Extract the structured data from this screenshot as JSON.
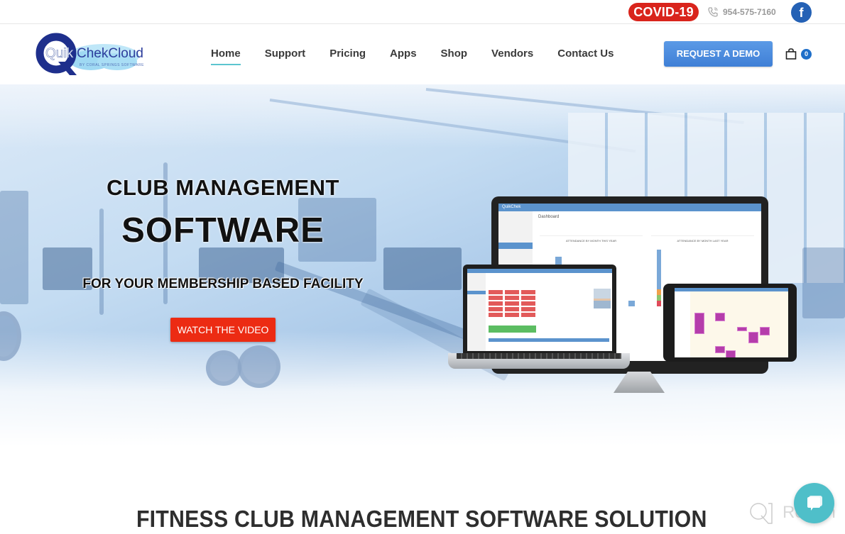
{
  "topbar": {
    "covid_label": "COVID-19",
    "phone_icon": "phone-icon",
    "phone": "954-575-7160",
    "facebook_icon": "facebook-icon",
    "facebook_glyph": "f"
  },
  "header": {
    "logo": {
      "name": "QuikChek cloud",
      "tagline": "BY CORAL SPRINGS SOFTWARE"
    },
    "nav": [
      {
        "label": "Home",
        "active": true
      },
      {
        "label": "Support",
        "active": false
      },
      {
        "label": "Pricing",
        "active": false
      },
      {
        "label": "Apps",
        "active": false
      },
      {
        "label": "Shop",
        "active": false
      },
      {
        "label": "Vendors",
        "active": false
      },
      {
        "label": "Contact Us",
        "active": false
      }
    ],
    "demo_button": "REQUEST A DEMO",
    "cart_icon": "shopping-bag-icon",
    "cart_count": "0"
  },
  "hero": {
    "title_line1": "CLUB MANAGEMENT",
    "title_line2": "SOFTWARE",
    "subtitle": "FOR YOUR MEMBERSHIP BASED FACILITY",
    "cta": "WATCH THE VIDEO",
    "devices": {
      "monitor_app_name": "QuikChek",
      "monitor_page": "Dashboard",
      "monitor_chart1_title": "ATTENDANCE BY MONTH THIS YEAR",
      "monitor_chart2_title": "ATTENDANCE BY MONTH LAST YEAR"
    }
  },
  "section": {
    "title": "FITNESS CLUB MANAGEMENT SOFTWARE SOLUTION"
  },
  "widgets": {
    "chat_icon": "chat-bubble-icon",
    "watermark": "Revain"
  },
  "colors": {
    "covid": "#d9241c",
    "facebook": "#2461b5",
    "demo_button": "#4a8ad9",
    "cta": "#ec2b13",
    "nav_active_underline": "#5cc5cf",
    "chat": "#4fbfc9"
  }
}
